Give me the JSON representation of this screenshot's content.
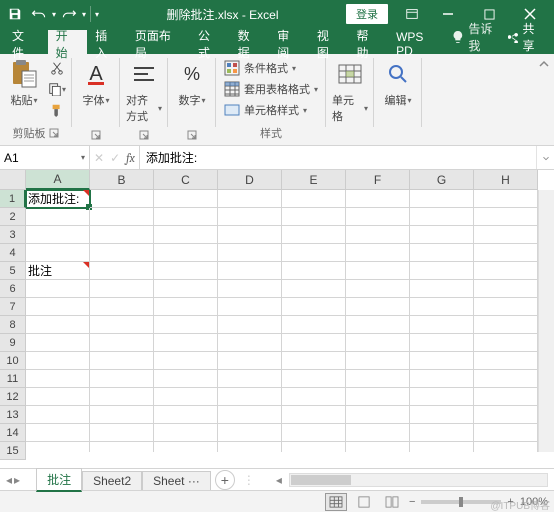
{
  "title": "删除批注.xlsx - Excel",
  "login": "登录",
  "tabs": {
    "file": "文件",
    "home": "开始",
    "insert": "插入",
    "layout": "页面布局",
    "formula": "公式",
    "data": "数据",
    "review": "审阅",
    "view": "视图",
    "help": "帮助",
    "wps": "WPS PD"
  },
  "tell_me": "告诉我",
  "share": "共享",
  "ribbon": {
    "clipboard": {
      "paste": "粘贴",
      "label": "剪贴板"
    },
    "font": {
      "btn": "字体",
      "label": "字体"
    },
    "align": {
      "btn": "对齐方式",
      "label": "对齐方式"
    },
    "number": {
      "btn": "数字",
      "label": "数字"
    },
    "styles": {
      "cond": "条件格式",
      "table": "套用表格格式",
      "cell": "单元格样式",
      "label": "样式"
    },
    "cells": {
      "btn": "单元格",
      "label": "单元格"
    },
    "editing": {
      "btn": "编辑",
      "label": "编辑"
    }
  },
  "name_box": "A1",
  "formula": "添加批注:",
  "columns": [
    "A",
    "B",
    "C",
    "D",
    "E",
    "F",
    "G",
    "H"
  ],
  "rows": [
    "1",
    "2",
    "3",
    "4",
    "5",
    "6",
    "7",
    "8",
    "9",
    "10",
    "11",
    "12",
    "13",
    "14",
    "15"
  ],
  "cells": {
    "A1": "添加批注:",
    "A5": "批注"
  },
  "sheets": {
    "s1": "批注",
    "s2": "Sheet2",
    "s3": "Sheet ···"
  },
  "zoom": "100%",
  "watermark": "@ITPUB博客"
}
